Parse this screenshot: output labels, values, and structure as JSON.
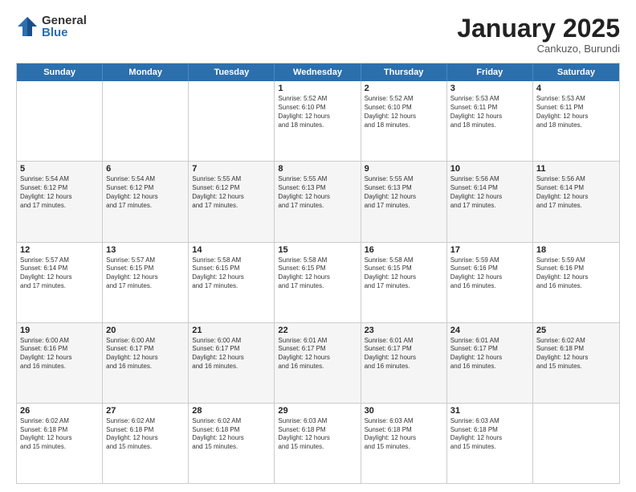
{
  "logo": {
    "general": "General",
    "blue": "Blue"
  },
  "title": "January 2025",
  "subtitle": "Cankuzo, Burundi",
  "header": {
    "days": [
      "Sunday",
      "Monday",
      "Tuesday",
      "Wednesday",
      "Thursday",
      "Friday",
      "Saturday"
    ]
  },
  "weeks": [
    {
      "alt": false,
      "cells": [
        {
          "day": "",
          "lines": []
        },
        {
          "day": "",
          "lines": []
        },
        {
          "day": "",
          "lines": []
        },
        {
          "day": "1",
          "lines": [
            "Sunrise: 5:52 AM",
            "Sunset: 6:10 PM",
            "Daylight: 12 hours",
            "and 18 minutes."
          ]
        },
        {
          "day": "2",
          "lines": [
            "Sunrise: 5:52 AM",
            "Sunset: 6:10 PM",
            "Daylight: 12 hours",
            "and 18 minutes."
          ]
        },
        {
          "day": "3",
          "lines": [
            "Sunrise: 5:53 AM",
            "Sunset: 6:11 PM",
            "Daylight: 12 hours",
            "and 18 minutes."
          ]
        },
        {
          "day": "4",
          "lines": [
            "Sunrise: 5:53 AM",
            "Sunset: 6:11 PM",
            "Daylight: 12 hours",
            "and 18 minutes."
          ]
        }
      ]
    },
    {
      "alt": true,
      "cells": [
        {
          "day": "5",
          "lines": [
            "Sunrise: 5:54 AM",
            "Sunset: 6:12 PM",
            "Daylight: 12 hours",
            "and 17 minutes."
          ]
        },
        {
          "day": "6",
          "lines": [
            "Sunrise: 5:54 AM",
            "Sunset: 6:12 PM",
            "Daylight: 12 hours",
            "and 17 minutes."
          ]
        },
        {
          "day": "7",
          "lines": [
            "Sunrise: 5:55 AM",
            "Sunset: 6:12 PM",
            "Daylight: 12 hours",
            "and 17 minutes."
          ]
        },
        {
          "day": "8",
          "lines": [
            "Sunrise: 5:55 AM",
            "Sunset: 6:13 PM",
            "Daylight: 12 hours",
            "and 17 minutes."
          ]
        },
        {
          "day": "9",
          "lines": [
            "Sunrise: 5:55 AM",
            "Sunset: 6:13 PM",
            "Daylight: 12 hours",
            "and 17 minutes."
          ]
        },
        {
          "day": "10",
          "lines": [
            "Sunrise: 5:56 AM",
            "Sunset: 6:14 PM",
            "Daylight: 12 hours",
            "and 17 minutes."
          ]
        },
        {
          "day": "11",
          "lines": [
            "Sunrise: 5:56 AM",
            "Sunset: 6:14 PM",
            "Daylight: 12 hours",
            "and 17 minutes."
          ]
        }
      ]
    },
    {
      "alt": false,
      "cells": [
        {
          "day": "12",
          "lines": [
            "Sunrise: 5:57 AM",
            "Sunset: 6:14 PM",
            "Daylight: 12 hours",
            "and 17 minutes."
          ]
        },
        {
          "day": "13",
          "lines": [
            "Sunrise: 5:57 AM",
            "Sunset: 6:15 PM",
            "Daylight: 12 hours",
            "and 17 minutes."
          ]
        },
        {
          "day": "14",
          "lines": [
            "Sunrise: 5:58 AM",
            "Sunset: 6:15 PM",
            "Daylight: 12 hours",
            "and 17 minutes."
          ]
        },
        {
          "day": "15",
          "lines": [
            "Sunrise: 5:58 AM",
            "Sunset: 6:15 PM",
            "Daylight: 12 hours",
            "and 17 minutes."
          ]
        },
        {
          "day": "16",
          "lines": [
            "Sunrise: 5:58 AM",
            "Sunset: 6:15 PM",
            "Daylight: 12 hours",
            "and 17 minutes."
          ]
        },
        {
          "day": "17",
          "lines": [
            "Sunrise: 5:59 AM",
            "Sunset: 6:16 PM",
            "Daylight: 12 hours",
            "and 16 minutes."
          ]
        },
        {
          "day": "18",
          "lines": [
            "Sunrise: 5:59 AM",
            "Sunset: 6:16 PM",
            "Daylight: 12 hours",
            "and 16 minutes."
          ]
        }
      ]
    },
    {
      "alt": true,
      "cells": [
        {
          "day": "19",
          "lines": [
            "Sunrise: 6:00 AM",
            "Sunset: 6:16 PM",
            "Daylight: 12 hours",
            "and 16 minutes."
          ]
        },
        {
          "day": "20",
          "lines": [
            "Sunrise: 6:00 AM",
            "Sunset: 6:17 PM",
            "Daylight: 12 hours",
            "and 16 minutes."
          ]
        },
        {
          "day": "21",
          "lines": [
            "Sunrise: 6:00 AM",
            "Sunset: 6:17 PM",
            "Daylight: 12 hours",
            "and 16 minutes."
          ]
        },
        {
          "day": "22",
          "lines": [
            "Sunrise: 6:01 AM",
            "Sunset: 6:17 PM",
            "Daylight: 12 hours",
            "and 16 minutes."
          ]
        },
        {
          "day": "23",
          "lines": [
            "Sunrise: 6:01 AM",
            "Sunset: 6:17 PM",
            "Daylight: 12 hours",
            "and 16 minutes."
          ]
        },
        {
          "day": "24",
          "lines": [
            "Sunrise: 6:01 AM",
            "Sunset: 6:17 PM",
            "Daylight: 12 hours",
            "and 16 minutes."
          ]
        },
        {
          "day": "25",
          "lines": [
            "Sunrise: 6:02 AM",
            "Sunset: 6:18 PM",
            "Daylight: 12 hours",
            "and 15 minutes."
          ]
        }
      ]
    },
    {
      "alt": false,
      "cells": [
        {
          "day": "26",
          "lines": [
            "Sunrise: 6:02 AM",
            "Sunset: 6:18 PM",
            "Daylight: 12 hours",
            "and 15 minutes."
          ]
        },
        {
          "day": "27",
          "lines": [
            "Sunrise: 6:02 AM",
            "Sunset: 6:18 PM",
            "Daylight: 12 hours",
            "and 15 minutes."
          ]
        },
        {
          "day": "28",
          "lines": [
            "Sunrise: 6:02 AM",
            "Sunset: 6:18 PM",
            "Daylight: 12 hours",
            "and 15 minutes."
          ]
        },
        {
          "day": "29",
          "lines": [
            "Sunrise: 6:03 AM",
            "Sunset: 6:18 PM",
            "Daylight: 12 hours",
            "and 15 minutes."
          ]
        },
        {
          "day": "30",
          "lines": [
            "Sunrise: 6:03 AM",
            "Sunset: 6:18 PM",
            "Daylight: 12 hours",
            "and 15 minutes."
          ]
        },
        {
          "day": "31",
          "lines": [
            "Sunrise: 6:03 AM",
            "Sunset: 6:18 PM",
            "Daylight: 12 hours",
            "and 15 minutes."
          ]
        },
        {
          "day": "",
          "lines": []
        }
      ]
    }
  ]
}
